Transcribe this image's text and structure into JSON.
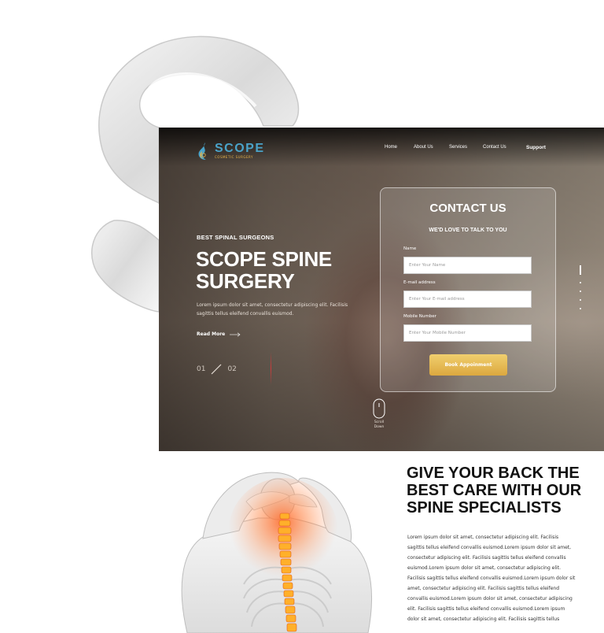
{
  "logo": {
    "name": "SCOPE",
    "subtitle": "COSMETIC SURGERY"
  },
  "nav": {
    "items": [
      "Home",
      "About Us",
      "Services",
      "Contact Us",
      "Support"
    ]
  },
  "hero": {
    "eyebrow": "BEST SPINAL SURGEONS",
    "title": "SCOPE SPINE SURGERY",
    "description": "Lorem ipsum dolor sit amet, consectetur adipiscing elit. Facilisis sagittis tellus eleifend convallis euismod.",
    "read_more": "Read More",
    "slide_current": "01",
    "slide_total": "02",
    "scroll_label": "Scroll Down"
  },
  "contact": {
    "title": "CONTACT US",
    "subtitle": "WE'D LOVE TO TALK TO YOU",
    "name_label": "Name",
    "name_placeholder": "Enter Your Name",
    "email_label": "E-mail address",
    "email_placeholder": "Enter Your E-mail address",
    "mobile_label": "Mobile Number",
    "mobile_placeholder": "Enter Your Mobile Number",
    "button": "Book Appoinment"
  },
  "section": {
    "title": "GIVE YOUR BACK THE BEST CARE WITH OUR SPINE SPECIALISTS",
    "body": "Lorem ipsum dolor sit amet, consectetur adipiscing elit. Facilisis sagittis tellus eleifend convallis euismod.Lorem ipsum dolor sit amet, consectetur adipiscing elit. Facilisis sagittis tellus eleifend convallis euismod.Lorem ipsum dolor sit amet, consectetur adipiscing elit. Facilisis sagittis tellus eleifend convallis euismod.Lorem ipsum dolor sit amet, consectetur adipiscing elit. Facilisis sagittis tellus eleifend convallis euismod.Lorem ipsum dolor sit amet, consectetur adipiscing elit. Facilisis sagittis tellus eleifend convallis euismod.Lorem ipsum dolor sit amet, consectetur adipiscing elit. Facilisis sagittis tellus"
  },
  "colors": {
    "brand_blue": "#4aa3c9",
    "brand_gold": "#dca83f",
    "accent_red": "#d03a3a"
  },
  "icons": [
    "logo-flame-icon",
    "arrow-right-icon",
    "mouse-icon",
    "spine-illustration"
  ]
}
